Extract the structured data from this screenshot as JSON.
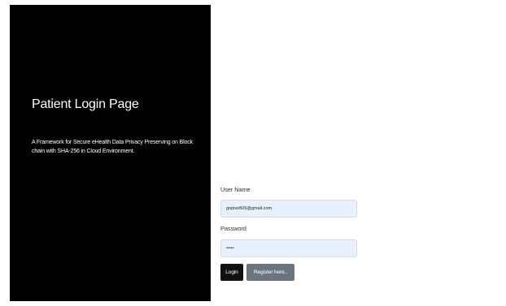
{
  "left_panel": {
    "title": "Patient Login Page",
    "description": "A Framework for Secure eHealth Data Privacy Preserving on Block chain with SHA-256 in Cloud Environment."
  },
  "form": {
    "username_label": "User Name",
    "username_value": "gopisoft26@gmail.com",
    "password_label": "Password",
    "password_value": "•••••",
    "login_label": "Login",
    "register_label": "Register here.."
  },
  "colors": {
    "panel_bg": "#000000",
    "input_bg": "#e8f0fe",
    "login_btn": "#111111",
    "register_btn": "#6c757d"
  }
}
